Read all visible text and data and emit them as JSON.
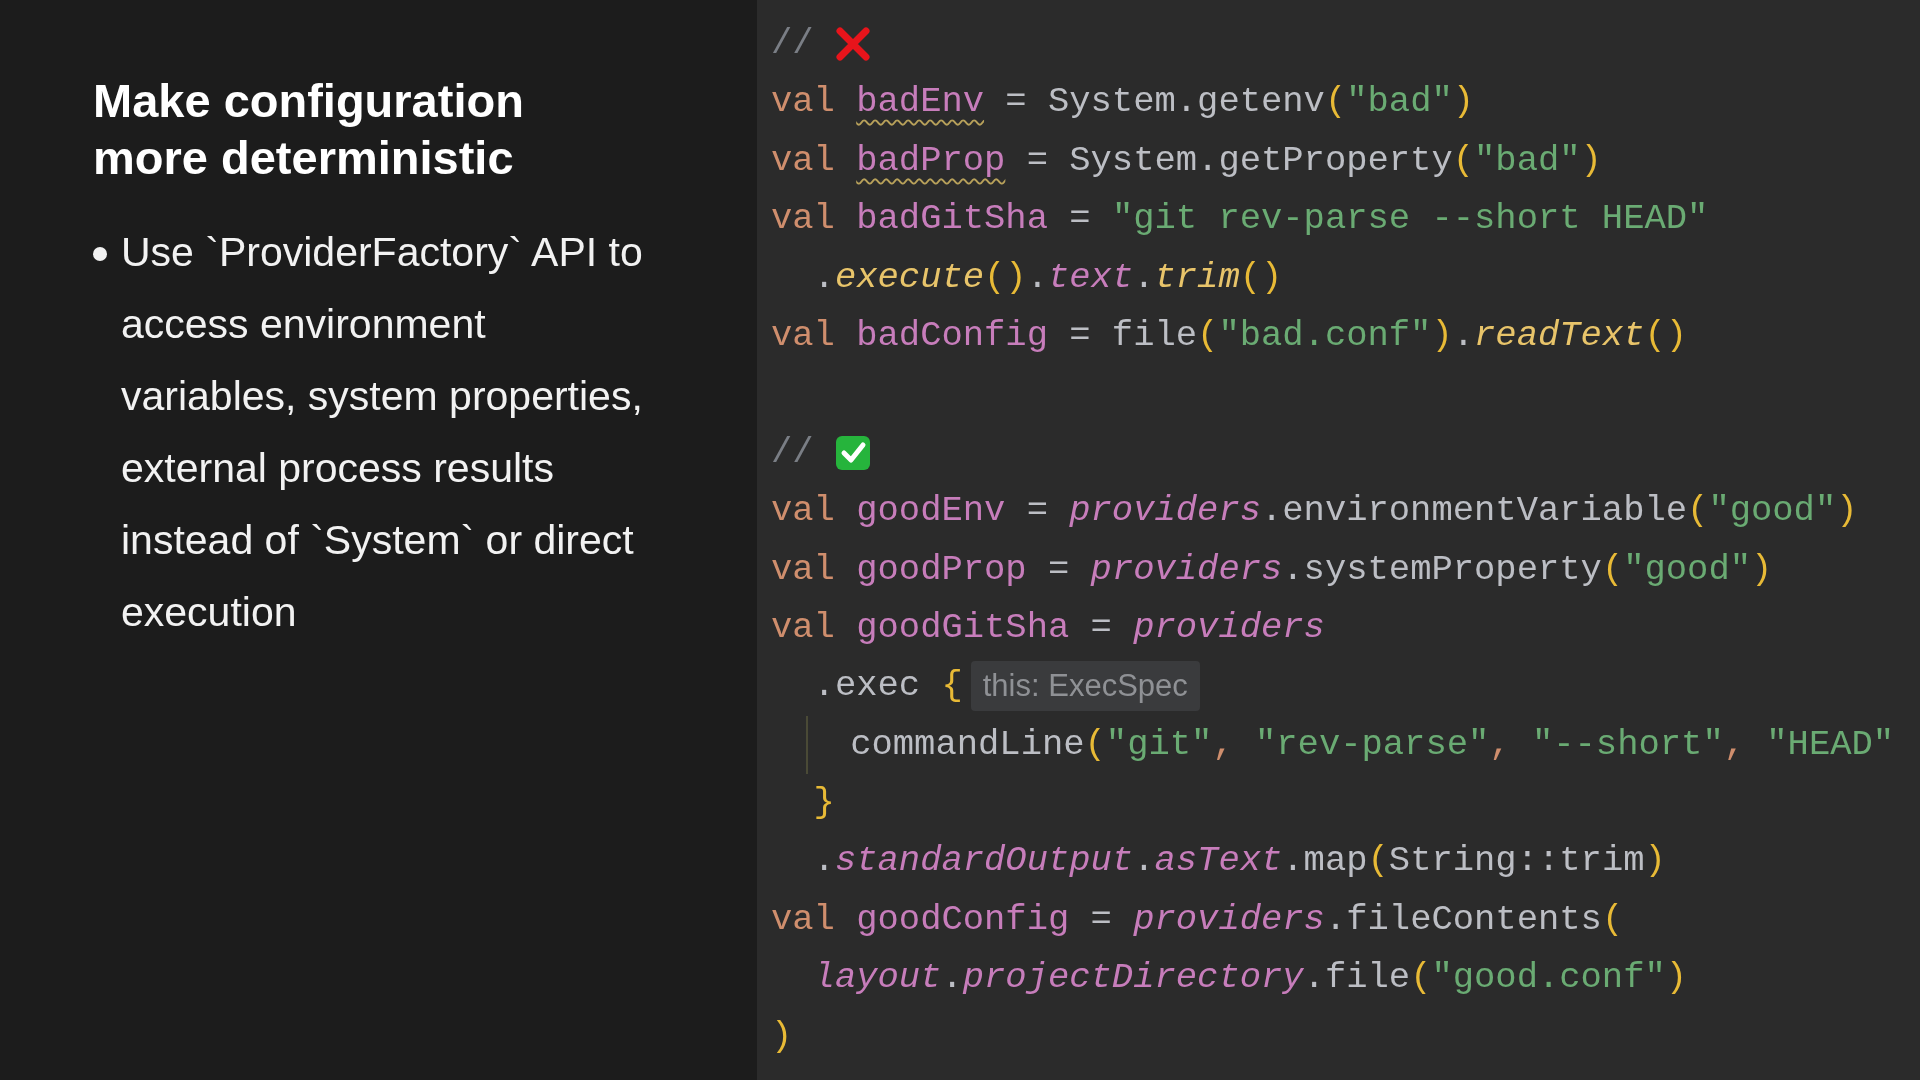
{
  "slide": {
    "title": "Make configuration more deterministic",
    "bullets": [
      "Use `ProviderFactory` API to access environment variables, system properties, external process results instead of `System` or direct execution"
    ]
  },
  "code": {
    "lines": [
      {
        "tokens": [
          {
            "kind": "comment",
            "text": "// "
          },
          {
            "kind": "cross"
          }
        ]
      },
      {
        "tokens": [
          {
            "kind": "keyword",
            "text": "val "
          },
          {
            "kind": "variable",
            "text": "badEnv",
            "warning": true
          },
          {
            "kind": "plain",
            "text": " = System.getenv"
          },
          {
            "kind": "paren",
            "text": "("
          },
          {
            "kind": "string",
            "text": "\"bad\""
          },
          {
            "kind": "paren",
            "text": ")"
          }
        ]
      },
      {
        "tokens": [
          {
            "kind": "keyword",
            "text": "val "
          },
          {
            "kind": "variable",
            "text": "badProp",
            "warning": true
          },
          {
            "kind": "plain",
            "text": " = System.getProperty"
          },
          {
            "kind": "paren",
            "text": "("
          },
          {
            "kind": "string",
            "text": "\"bad\""
          },
          {
            "kind": "paren",
            "text": ")"
          }
        ]
      },
      {
        "tokens": [
          {
            "kind": "keyword",
            "text": "val "
          },
          {
            "kind": "variable",
            "text": "badGitSha",
            "warning": false
          },
          {
            "kind": "plain",
            "text": " = "
          },
          {
            "kind": "string",
            "text": "\"git rev-parse --short HEAD\""
          }
        ]
      },
      {
        "tokens": [
          {
            "kind": "plain",
            "text": "  ."
          },
          {
            "kind": "call",
            "text": "execute"
          },
          {
            "kind": "paren",
            "text": "()"
          },
          {
            "kind": "plain",
            "text": "."
          },
          {
            "kind": "property",
            "text": "text"
          },
          {
            "kind": "plain",
            "text": "."
          },
          {
            "kind": "call",
            "text": "trim"
          },
          {
            "kind": "paren",
            "text": "()"
          }
        ]
      },
      {
        "tokens": [
          {
            "kind": "keyword",
            "text": "val "
          },
          {
            "kind": "variable",
            "text": "badConfig",
            "warning": false
          },
          {
            "kind": "plain",
            "text": " = file"
          },
          {
            "kind": "paren",
            "text": "("
          },
          {
            "kind": "string",
            "text": "\"bad.conf\""
          },
          {
            "kind": "paren",
            "text": ")"
          },
          {
            "kind": "plain",
            "text": "."
          },
          {
            "kind": "call",
            "text": "readText"
          },
          {
            "kind": "paren",
            "text": "()"
          }
        ]
      },
      {
        "kind": "blank"
      },
      {
        "tokens": [
          {
            "kind": "comment",
            "text": "// "
          },
          {
            "kind": "check"
          }
        ]
      },
      {
        "tokens": [
          {
            "kind": "keyword",
            "text": "val "
          },
          {
            "kind": "variable",
            "text": "goodEnv",
            "warning": false
          },
          {
            "kind": "plain",
            "text": " = "
          },
          {
            "kind": "property",
            "text": "providers"
          },
          {
            "kind": "plain",
            "text": ".environmentVariable"
          },
          {
            "kind": "paren",
            "text": "("
          },
          {
            "kind": "string",
            "text": "\"good\""
          },
          {
            "kind": "paren",
            "text": ")"
          }
        ]
      },
      {
        "tokens": [
          {
            "kind": "keyword",
            "text": "val "
          },
          {
            "kind": "variable",
            "text": "goodProp",
            "warning": false
          },
          {
            "kind": "plain",
            "text": " = "
          },
          {
            "kind": "property",
            "text": "providers"
          },
          {
            "kind": "plain",
            "text": ".systemProperty"
          },
          {
            "kind": "paren",
            "text": "("
          },
          {
            "kind": "string",
            "text": "\"good\""
          },
          {
            "kind": "paren",
            "text": ")"
          }
        ]
      },
      {
        "tokens": [
          {
            "kind": "keyword",
            "text": "val "
          },
          {
            "kind": "variable",
            "text": "goodGitSha",
            "warning": false
          },
          {
            "kind": "plain",
            "text": " = "
          },
          {
            "kind": "property",
            "text": "providers"
          }
        ]
      },
      {
        "tokens": [
          {
            "kind": "plain",
            "text": "  .exec "
          },
          {
            "kind": "paren",
            "text": "{"
          },
          {
            "kind": "hint",
            "text": "this: ExecSpec"
          }
        ]
      },
      {
        "tokens": [
          {
            "kind": "indent"
          },
          {
            "kind": "guide"
          },
          {
            "kind": "plain",
            "text": "  commandLine"
          },
          {
            "kind": "paren",
            "text": "("
          },
          {
            "kind": "string",
            "text": "\"git\""
          },
          {
            "kind": "punct",
            "text": ", "
          },
          {
            "kind": "string",
            "text": "\"rev-parse\""
          },
          {
            "kind": "punct",
            "text": ", "
          },
          {
            "kind": "string",
            "text": "\"--short\""
          },
          {
            "kind": "punct",
            "text": ", "
          },
          {
            "kind": "string",
            "text": "\"HEAD\""
          }
        ]
      },
      {
        "tokens": [
          {
            "kind": "indent"
          },
          {
            "kind": "paren",
            "text": "}"
          }
        ]
      },
      {
        "tokens": [
          {
            "kind": "plain",
            "text": "  ."
          },
          {
            "kind": "property",
            "text": "standardOutput"
          },
          {
            "kind": "plain",
            "text": "."
          },
          {
            "kind": "property",
            "text": "asText"
          },
          {
            "kind": "plain",
            "text": ".map"
          },
          {
            "kind": "paren",
            "text": "("
          },
          {
            "kind": "plain",
            "text": "String::trim"
          },
          {
            "kind": "paren",
            "text": ")"
          }
        ]
      },
      {
        "tokens": [
          {
            "kind": "keyword",
            "text": "val "
          },
          {
            "kind": "variable",
            "text": "goodConfig",
            "warning": false
          },
          {
            "kind": "plain",
            "text": " = "
          },
          {
            "kind": "property",
            "text": "providers"
          },
          {
            "kind": "plain",
            "text": ".fileContents"
          },
          {
            "kind": "paren",
            "text": "("
          }
        ]
      },
      {
        "tokens": [
          {
            "kind": "indent"
          },
          {
            "kind": "property",
            "text": "layout"
          },
          {
            "kind": "plain",
            "text": "."
          },
          {
            "kind": "property",
            "text": "projectDirectory"
          },
          {
            "kind": "plain",
            "text": ".file"
          },
          {
            "kind": "paren",
            "text": "("
          },
          {
            "kind": "string",
            "text": "\"good.conf\""
          },
          {
            "kind": "paren",
            "text": ")"
          }
        ]
      },
      {
        "tokens": [
          {
            "kind": "paren",
            "text": ")"
          }
        ]
      }
    ]
  }
}
